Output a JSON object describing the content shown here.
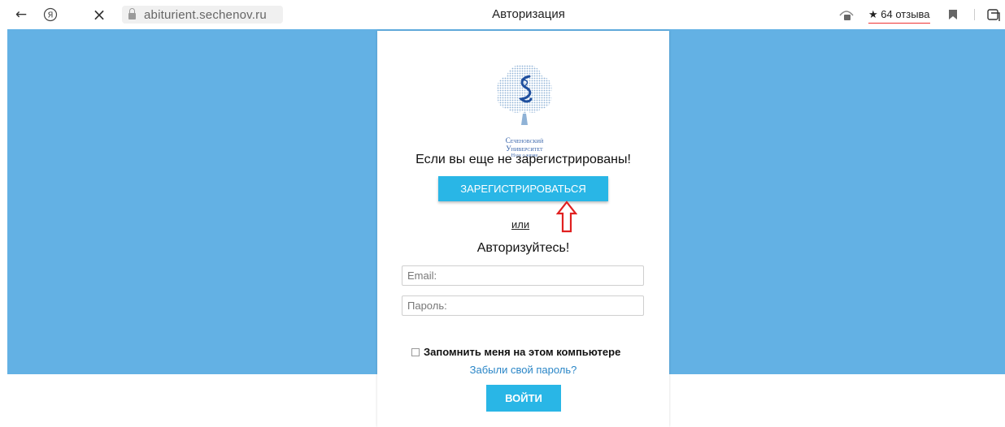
{
  "browser": {
    "back_icon": "←",
    "yandex_icon": "Я",
    "close_icon": "×",
    "url": "abiturient.sechenov.ru",
    "tab_title": "Авторизация",
    "reviews_label": "★ 64 отзыва"
  },
  "logo": {
    "line1": "Сеченовский",
    "line2": "Университет",
    "line3": "Наук о жизни"
  },
  "register": {
    "heading": "Если вы еще не зарегистрированы!",
    "button_label": "ЗАРЕГИСТРИРОВАТЬСЯ",
    "or_label": "или"
  },
  "login": {
    "heading": "Авторизуйтесь!",
    "email_placeholder": "Email:",
    "password_placeholder": "Пароль:",
    "remember_label": "Запомнить меня на этом компьютере",
    "forgot_label": "Забыли свой пароль?",
    "submit_label": "ВОЙТИ"
  },
  "colors": {
    "banner": "#63b1e4",
    "button": "#29b6e6",
    "arrow": "#e02020"
  }
}
